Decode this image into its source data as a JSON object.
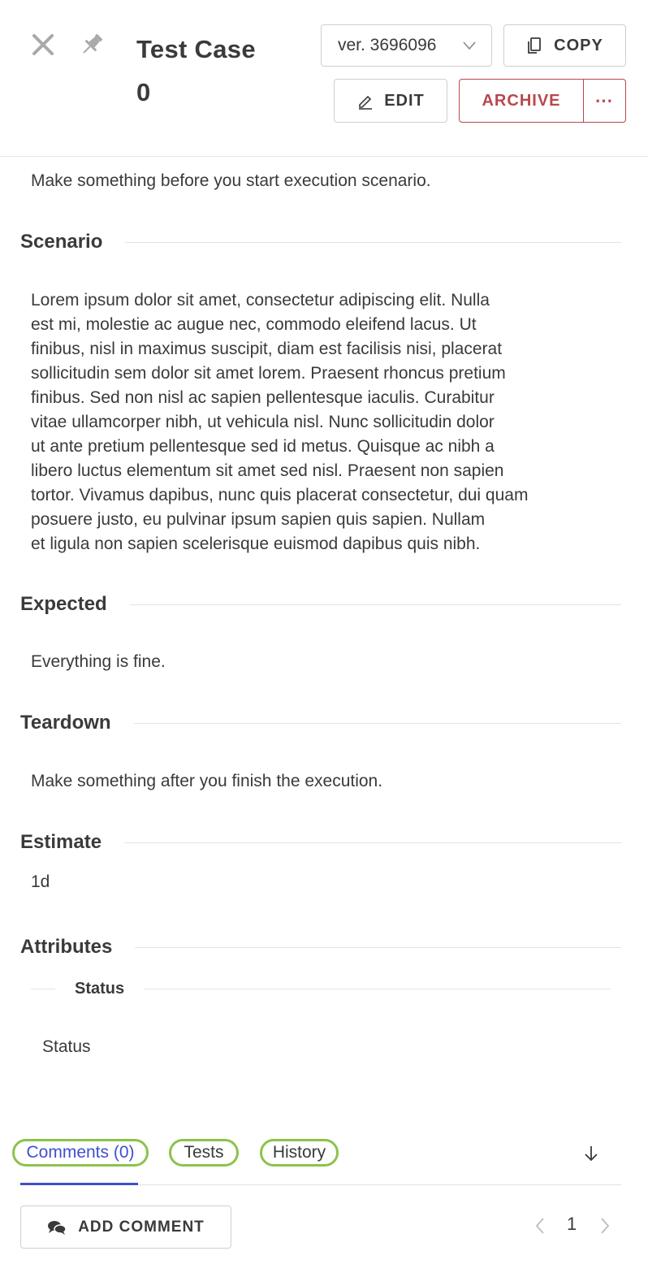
{
  "header": {
    "title_line1": "Test Case",
    "title_line2": "0",
    "close_icon": "close-icon",
    "pin_icon": "pin-icon",
    "version_label": "ver. 3696096",
    "copy_label": "COPY",
    "edit_label": "EDIT",
    "archive_label": "ARCHIVE",
    "more_label": "⋯"
  },
  "sections": {
    "precondition_text": "Make something before you start execution scenario.",
    "scenario_label": "Scenario",
    "scenario_lines": [
      "Lorem ipsum dolor sit amet, consectetur adipiscing elit. Nulla",
      "est mi, molestie ac augue nec, commodo eleifend lacus. Ut",
      "finibus, nisl in maximus suscipit, diam est facilisis nisi, placerat",
      "sollicitudin sem dolor sit amet lorem. Praesent rhoncus pretium",
      "finibus. Sed non nisl ac sapien pellentesque iaculis. Curabitur",
      "vitae ullamcorper nibh, ut vehicula nisl. Nunc sollicitudin dolor",
      "ut ante pretium pellentesque sed id metus. Quisque ac nibh a",
      "libero luctus elementum sit amet sed nisl. Praesent non sapien",
      "tortor. Vivamus dapibus, nunc quis placerat consectetur, dui quam",
      "posuere justo, eu pulvinar ipsum sapien quis sapien. Nullam",
      "et ligula non sapien scelerisque euismod dapibus quis nibh."
    ],
    "expected_label": "Expected",
    "expected_text": "Everything is fine.",
    "teardown_label": "Teardown",
    "teardown_text": "Make something after you finish the execution.",
    "estimate_label": "Estimate",
    "estimate_value": "1d",
    "attributes_label": "Attributes",
    "status_label": "Status",
    "status_value": "Status"
  },
  "tabs": {
    "comments": "Comments (0)",
    "tests": "Tests",
    "history": "History",
    "sort_icon": "arrow-down-icon"
  },
  "comments": {
    "add_label": "ADD COMMENT",
    "page_number": "1"
  },
  "colors": {
    "accent_blue": "#3f4fd1",
    "archive_red": "#b8474d",
    "tab_outline_green": "#8bc34a"
  }
}
